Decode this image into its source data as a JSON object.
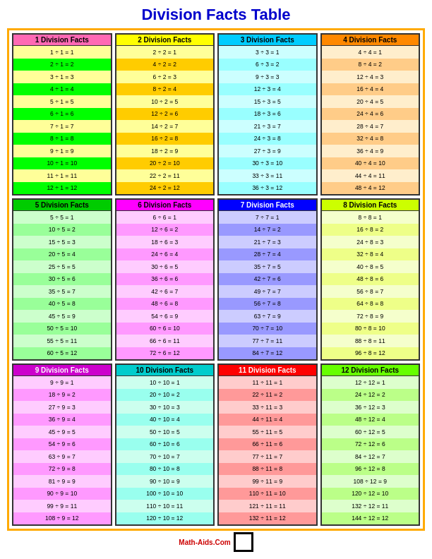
{
  "title": "Division Facts Table",
  "tables": [
    {
      "id": 1,
      "header": "1 Division Facts",
      "divisor": 1,
      "facts": [
        "1 ÷ 1 = 1",
        "2 ÷ 1 = 2",
        "3 ÷ 1 = 3",
        "4 ÷ 1 = 4",
        "5 ÷ 1 = 5",
        "6 ÷ 1 = 6",
        "7 ÷ 1 = 7",
        "8 ÷ 1 = 8",
        "9 ÷ 1 = 9",
        "10 ÷ 1 = 10",
        "11 ÷ 1 = 11",
        "12 ÷ 1 = 12"
      ]
    },
    {
      "id": 2,
      "header": "2 Division Facts",
      "divisor": 2,
      "facts": [
        "2 ÷ 2 = 1",
        "4 ÷ 2 = 2",
        "6 ÷ 2 = 3",
        "8 ÷ 2 = 4",
        "10 ÷ 2 = 5",
        "12 ÷ 2 = 6",
        "14 ÷ 2 = 7",
        "16 ÷ 2 = 8",
        "18 ÷ 2 = 9",
        "20 ÷ 2 = 10",
        "22 ÷ 2 = 11",
        "24 ÷ 2 = 12"
      ]
    },
    {
      "id": 3,
      "header": "3 Division Facts",
      "divisor": 3,
      "facts": [
        "3 ÷ 3 = 1",
        "6 ÷ 3 = 2",
        "9 ÷ 3 = 3",
        "12 ÷ 3 = 4",
        "15 ÷ 3 = 5",
        "18 ÷ 3 = 6",
        "21 ÷ 3 = 7",
        "24 ÷ 3 = 8",
        "27 ÷ 3 = 9",
        "30 ÷ 3 = 10",
        "33 ÷ 3 = 11",
        "36 ÷ 3 = 12"
      ]
    },
    {
      "id": 4,
      "header": "4 Division Facts",
      "divisor": 4,
      "facts": [
        "4 ÷ 4 = 1",
        "8 ÷ 4 = 2",
        "12 ÷ 4 = 3",
        "16 ÷ 4 = 4",
        "20 ÷ 4 = 5",
        "24 ÷ 4 = 6",
        "28 ÷ 4 = 7",
        "32 ÷ 4 = 8",
        "36 ÷ 4 = 9",
        "40 ÷ 4 = 10",
        "44 ÷ 4 = 11",
        "48 ÷ 4 = 12"
      ]
    },
    {
      "id": 5,
      "header": "5 Division Facts",
      "divisor": 5,
      "facts": [
        "5 ÷ 5 = 1",
        "10 ÷ 5 = 2",
        "15 ÷ 5 = 3",
        "20 ÷ 5 = 4",
        "25 ÷ 5 = 5",
        "30 ÷ 5 = 6",
        "35 ÷ 5 = 7",
        "40 ÷ 5 = 8",
        "45 ÷ 5 = 9",
        "50 ÷ 5 = 10",
        "55 ÷ 5 = 11",
        "60 ÷ 5 = 12"
      ]
    },
    {
      "id": 6,
      "header": "6 Division Facts",
      "divisor": 6,
      "facts": [
        "6 ÷ 6 = 1",
        "12 ÷ 6 = 2",
        "18 ÷ 6 = 3",
        "24 ÷ 6 = 4",
        "30 ÷ 6 = 5",
        "36 ÷ 6 = 6",
        "42 ÷ 6 = 7",
        "48 ÷ 6 = 8",
        "54 ÷ 6 = 9",
        "60 ÷ 6 = 10",
        "66 ÷ 6 = 11",
        "72 ÷ 6 = 12"
      ]
    },
    {
      "id": 7,
      "header": "7 Division Facts",
      "divisor": 7,
      "facts": [
        "7 ÷ 7 = 1",
        "14 ÷ 7 = 2",
        "21 ÷ 7 = 3",
        "28 ÷ 7 = 4",
        "35 ÷ 7 = 5",
        "42 ÷ 7 = 6",
        "49 ÷ 7 = 7",
        "56 ÷ 7 = 8",
        "63 ÷ 7 = 9",
        "70 ÷ 7 = 10",
        "77 ÷ 7 = 11",
        "84 ÷ 7 = 12"
      ]
    },
    {
      "id": 8,
      "header": "8 Division Facts",
      "divisor": 8,
      "facts": [
        "8 ÷ 8 = 1",
        "16 ÷ 8 = 2",
        "24 ÷ 8 = 3",
        "32 ÷ 8 = 4",
        "40 ÷ 8 = 5",
        "48 ÷ 8 = 6",
        "56 ÷ 8 = 7",
        "64 ÷ 8 = 8",
        "72 ÷ 8 = 9",
        "80 ÷ 8 = 10",
        "88 ÷ 8 = 11",
        "96 ÷ 8 = 12"
      ]
    },
    {
      "id": 9,
      "header": "9 Division Facts",
      "divisor": 9,
      "facts": [
        "9 ÷ 9 = 1",
        "18 ÷ 9 = 2",
        "27 ÷ 9 = 3",
        "36 ÷ 9 = 4",
        "45 ÷ 9 = 5",
        "54 ÷ 9 = 6",
        "63 ÷ 9 = 7",
        "72 ÷ 9 = 8",
        "81 ÷ 9 = 9",
        "90 ÷ 9 = 10",
        "99 ÷ 9 = 11",
        "108 ÷ 9 = 12"
      ]
    },
    {
      "id": 10,
      "header": "10 Division Facts",
      "divisor": 10,
      "facts": [
        "10 ÷ 10 = 1",
        "20 ÷ 10 = 2",
        "30 ÷ 10 = 3",
        "40 ÷ 10 = 4",
        "50 ÷ 10 = 5",
        "60 ÷ 10 = 6",
        "70 ÷ 10 = 7",
        "80 ÷ 10 = 8",
        "90 ÷ 10 = 9",
        "100 ÷ 10 = 10",
        "110 ÷ 10 = 11",
        "120 ÷ 10 = 12"
      ]
    },
    {
      "id": 11,
      "header": "11 Division Facts",
      "divisor": 11,
      "facts": [
        "11 ÷ 11 = 1",
        "22 ÷ 11 = 2",
        "33 ÷ 11 = 3",
        "44 ÷ 11 = 4",
        "55 ÷ 11 = 5",
        "66 ÷ 11 = 6",
        "77 ÷ 11 = 7",
        "88 ÷ 11 = 8",
        "99 ÷ 11 = 9",
        "110 ÷ 11 = 10",
        "121 ÷ 11 = 11",
        "132 ÷ 11 = 12"
      ]
    },
    {
      "id": 12,
      "header": "12 Division Facts",
      "divisor": 12,
      "facts": [
        "12 ÷ 12 = 1",
        "24 ÷ 12 = 2",
        "36 ÷ 12 = 3",
        "48 ÷ 12 = 4",
        "60 ÷ 12 = 5",
        "72 ÷ 12 = 6",
        "84 ÷ 12 = 7",
        "96 ÷ 12 = 8",
        "108 ÷ 12 = 9",
        "120 ÷ 12 = 10",
        "132 ÷ 12 = 11",
        "144 ÷ 12 = 12"
      ]
    }
  ],
  "footer": {
    "logo_text": "Math-Aids.Com"
  }
}
